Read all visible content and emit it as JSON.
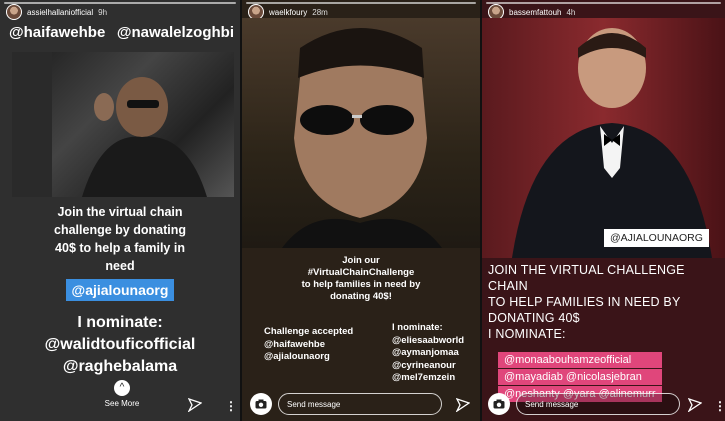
{
  "story1": {
    "username": "assielhallaniofficial",
    "time": "9h",
    "tags": [
      "@haifawehbe",
      "@nawalelzoghbi"
    ],
    "body": [
      "Join the virtual chain",
      "challenge by donating",
      "40$ to help a family in",
      "need"
    ],
    "highlight": "@ajialounaorg",
    "nominate": [
      "I nominate:",
      "@walidtouficofficial",
      "@raghebalama"
    ],
    "see_more": "See More"
  },
  "story2": {
    "username": "waelkfoury",
    "time": "28m",
    "body": [
      "Join our",
      "#VirtualChainChallenge",
      "to help families in need by",
      "donating 40$!"
    ],
    "accepted": [
      "Challenge accepted",
      "@haifawehbe",
      "@ajialounaorg"
    ],
    "nominate": [
      "I nominate:",
      "@eliesaabworld",
      "@aymanjomaa",
      "@cyrineanour",
      "@mel7emzein"
    ],
    "send_placeholder": "Send message"
  },
  "story3": {
    "username": "bassemfattouh",
    "time": "4h",
    "tag": "@AJIALOUNAORG",
    "body": [
      "JOIN THE VIRTUAL CHALLENGE CHAIN",
      "TO HELP FAMILIES IN NEED BY",
      "DONATING 40$",
      "I NOMINATE:"
    ],
    "highlights": [
      "@monaabouhamzeofficial",
      "@mayadiab @nicolasjebran",
      "@neshanty @yara @alinemurr"
    ],
    "send_placeholder": "Send message"
  },
  "colors": {
    "blue_highlight": "#3b8fe0",
    "pink_highlight": "#e0467b"
  }
}
